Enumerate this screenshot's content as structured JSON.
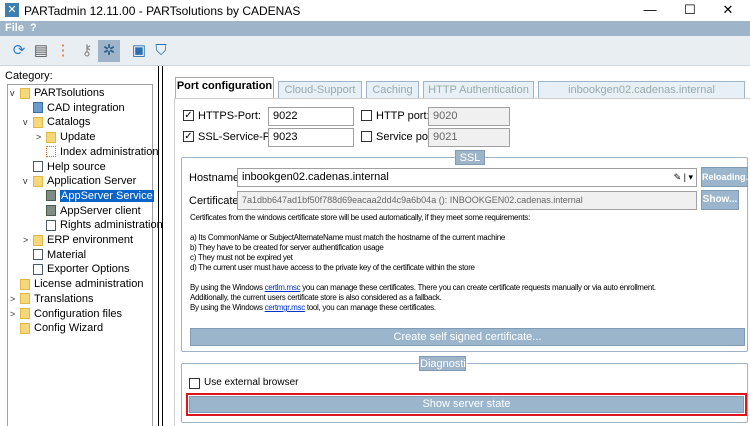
{
  "window": {
    "title": "PARTadmin 12.11.00 - PARTsolutions by CADENAS",
    "minimize": "—",
    "maximize": "☐",
    "close": "✕"
  },
  "menu": {
    "file": "File",
    "help": "?"
  },
  "sidebar": {
    "label": "Category:",
    "items": [
      {
        "label": "PARTsolutions",
        "level": 0,
        "icon": "folder",
        "exp": "v"
      },
      {
        "label": "CAD integration",
        "level": 1,
        "icon": "cad",
        "exp": ""
      },
      {
        "label": "Catalogs",
        "level": 1,
        "icon": "folder",
        "exp": "v"
      },
      {
        "label": "Update",
        "level": 2,
        "icon": "folder",
        "exp": ">"
      },
      {
        "label": "Index administration",
        "level": 2,
        "icon": "idx",
        "exp": ""
      },
      {
        "label": "Help source",
        "level": 1,
        "icon": "doc",
        "exp": ""
      },
      {
        "label": "Application Server",
        "level": 1,
        "icon": "folder",
        "exp": "v"
      },
      {
        "label": "AppServer Service",
        "level": 2,
        "icon": "srv",
        "exp": "",
        "selected": true
      },
      {
        "label": "AppServer client",
        "level": 2,
        "icon": "srv",
        "exp": ""
      },
      {
        "label": "Rights administration",
        "level": 2,
        "icon": "doc",
        "exp": ""
      },
      {
        "label": "ERP environment",
        "level": 1,
        "icon": "folder",
        "exp": ">"
      },
      {
        "label": "Material",
        "level": 1,
        "icon": "doc",
        "exp": ""
      },
      {
        "label": "Exporter Options",
        "level": 1,
        "icon": "doc",
        "exp": ""
      },
      {
        "label": "License administration",
        "level": 0,
        "icon": "folder",
        "exp": ""
      },
      {
        "label": "Translations",
        "level": 0,
        "icon": "folder",
        "exp": ">"
      },
      {
        "label": "Configuration files",
        "level": 0,
        "icon": "folder",
        "exp": ">"
      },
      {
        "label": "Config Wizard",
        "level": 0,
        "icon": "folder",
        "exp": ""
      }
    ]
  },
  "tabs": [
    "Port configuration",
    "Cloud-Support",
    "Caching",
    "HTTP Authentication",
    "inbookgen02.cadenas.internal"
  ],
  "ports": {
    "https_label": "HTTPS-Port:",
    "https_value": "9022",
    "https_checked": true,
    "ssl_label": "SSL-Service-Port:",
    "ssl_value": "9023",
    "ssl_checked": true,
    "http_label": "HTTP port:",
    "http_value": "9020",
    "http_checked": false,
    "service_label": "Service port:",
    "service_value": "9021",
    "service_checked": false
  },
  "ssl": {
    "title": "SSL",
    "hostname_label": "Hostname:",
    "hostname_value": "inbookgen02.cadenas.internal",
    "reloading": "Reloading...",
    "certificate_label": "Certificate:",
    "certificate_value": "7a1dbb647ad1bf50f788d69eacaa2dd4c9a6b04a (): INBOOKGEN02.cadenas.internal",
    "show": "Show...",
    "info": "Certificates from the windows certificate store will be used automatically, if they meet some requirements:",
    "req": [
      "a) Its CommonName or SubjectAlternateName must match the hostname of the current machine",
      "b) They have to be created for server authentification usage",
      "c) They must not be expired yet",
      "d) The current user must have access to the private key of the certificate within the store"
    ],
    "p1a": "By using the Windows ",
    "link1": "certlm.msc",
    "p1b": " you can manage these certificates. There you can create certificate requests manually or via auto enrollment.",
    "p2": "Additionally, the current users certificate store is also considered as a fallback.",
    "p3a": "By using the Windows ",
    "link2": "certmgr.msc",
    "p3b": " tool, you can manage these certificates.",
    "create": "Create self signed certificate..."
  },
  "diagnostic": {
    "title": "Diagnostic",
    "external_label": "Use external browser",
    "external_checked": false,
    "show_state": "Show server state"
  }
}
